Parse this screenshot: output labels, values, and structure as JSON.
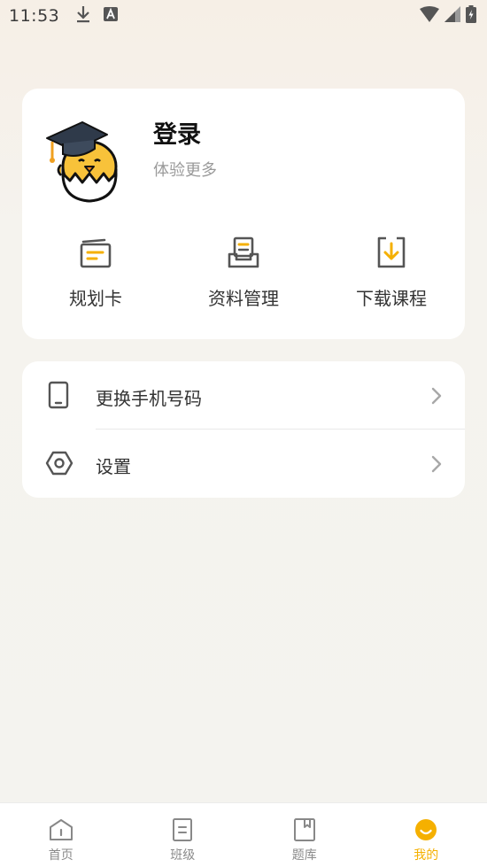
{
  "status_bar": {
    "time": "11:53"
  },
  "profile": {
    "title": "登录",
    "subtitle": "体验更多"
  },
  "quick_actions": [
    {
      "label": "规划卡",
      "icon": "planning-card-icon"
    },
    {
      "label": "资料管理",
      "icon": "materials-icon"
    },
    {
      "label": "下载课程",
      "icon": "download-icon"
    }
  ],
  "menu": [
    {
      "label": "更换手机号码",
      "icon": "phone-icon"
    },
    {
      "label": "设置",
      "icon": "settings-icon"
    }
  ],
  "tabs": [
    {
      "label": "首页",
      "icon": "home-icon",
      "active": false
    },
    {
      "label": "班级",
      "icon": "class-icon",
      "active": false
    },
    {
      "label": "题库",
      "icon": "question-bank-icon",
      "active": false
    },
    {
      "label": "我的",
      "icon": "mine-icon",
      "active": true
    }
  ],
  "colors": {
    "accent": "#f5b000",
    "icon_stroke": "#555555",
    "background": "#f4f3ef"
  }
}
